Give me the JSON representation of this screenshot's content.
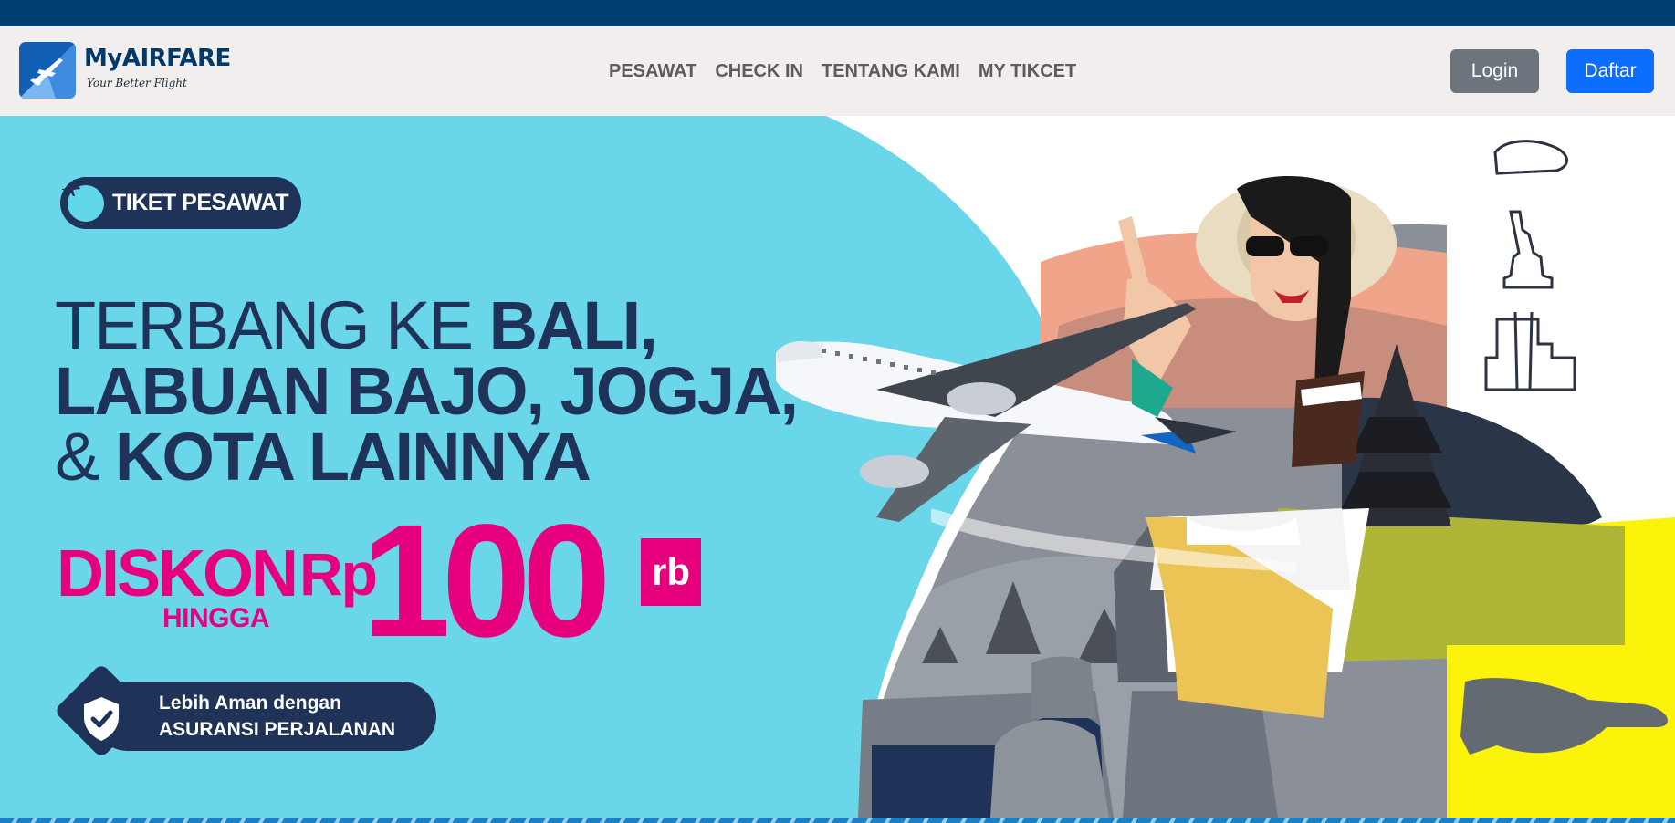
{
  "brand": {
    "name": "MyAIRFARE",
    "tagline": "Your Better Flight"
  },
  "nav": {
    "items": [
      {
        "label": "PESAWAT"
      },
      {
        "label": "CHECK IN"
      },
      {
        "label": "TENTANG KAMI"
      },
      {
        "label": "MY TIKCET"
      }
    ],
    "login_label": "Login",
    "register_label": "Daftar"
  },
  "hero": {
    "badge_text": "TIKET PESAWAT",
    "headline": {
      "line1_regular": "TERBANG KE ",
      "line1_bold": "BALI,",
      "line2": "LABUAN BAJO, JOGJA,",
      "line3_regular": "& ",
      "line3_bold": "KOTA LAINNYA"
    },
    "promo": {
      "prefix": "DISKON",
      "sub": "HINGGA",
      "currency": "Rp",
      "amount": "100",
      "unit": "rb"
    },
    "insurance": {
      "line1": "Lebih Aman dengan",
      "line2": "ASURANSI PERJALANAN"
    }
  },
  "colors": {
    "top_strip": "#003f73",
    "navbar_bg": "#f2eeee",
    "hero_bg": "#6ad6ea",
    "navy": "#1f3257",
    "magenta": "#e6007e",
    "login_button": "#6c757d",
    "register_button": "#0d6efd",
    "accent_yellow": "#fbf30a"
  },
  "icons": {
    "brand_logo": "airplane-logo-icon",
    "badge": "airplane-circle-icon",
    "insurance": "shield-check-icon"
  }
}
